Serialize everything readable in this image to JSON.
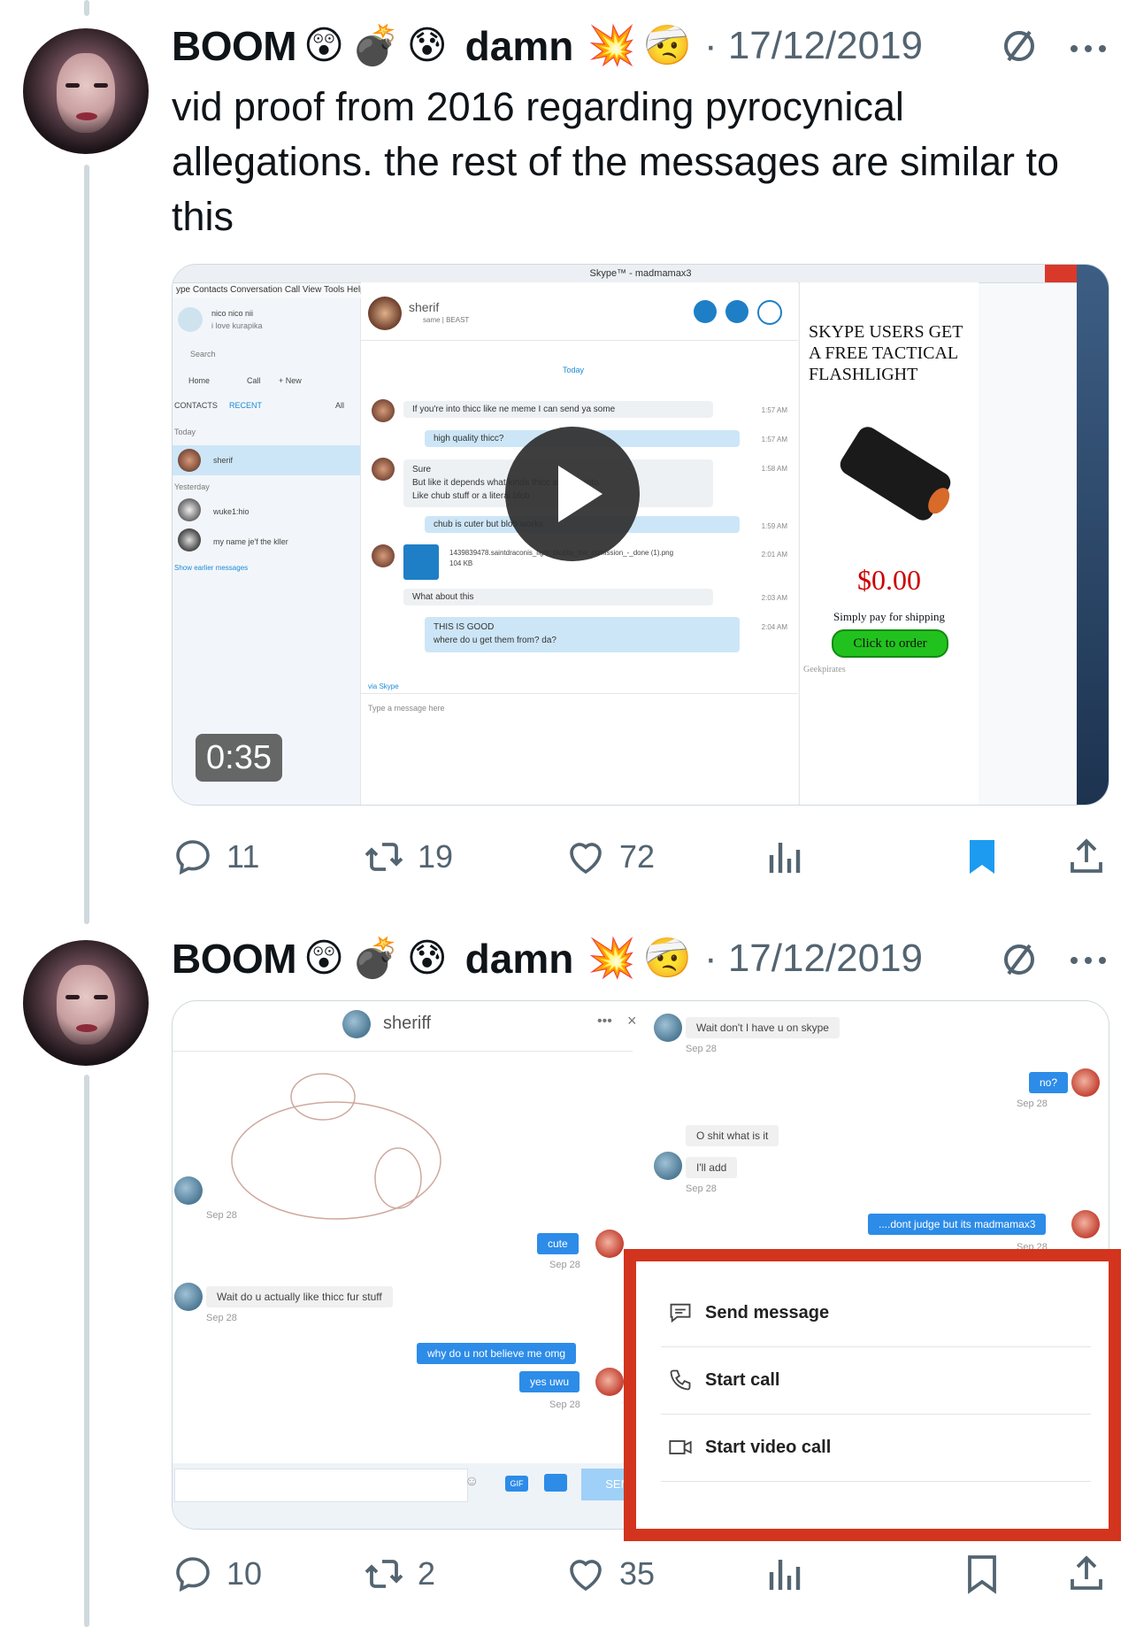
{
  "tweets": [
    {
      "author": "BOOM",
      "name_emoji": [
        "😲",
        "💣",
        "😰"
      ],
      "name_suffix": "damn",
      "suffix_emoji": [
        "💥",
        "🤕"
      ],
      "date": "· 17/12/2019",
      "text": "vid proof from 2016 regarding pyrocynical allegations. the rest of the messages are similar to this",
      "video": {
        "duration": "0:35",
        "skype": {
          "window_title": "Skype™ - madmamax3",
          "menu": "ype   Contacts   Conversation   Call   View   Tools   Help",
          "profile_name": "nico nico nii",
          "profile_status": "i love kurapika",
          "search": "Search",
          "nav": [
            "Home",
            "Call",
            "+ New"
          ],
          "tabs": [
            "CONTACTS",
            "RECENT",
            "All"
          ],
          "groups": [
            "Today",
            "Yesterday"
          ],
          "contacts": [
            "sherif",
            "wuke1:hio",
            "my name je'f the kller"
          ],
          "show_earlier": "Show earlier messages",
          "chat_name": "sherif",
          "chat_status": "same | BEAST",
          "day_label": "Today",
          "messages": [
            {
              "dir": "in",
              "text": "If you're into thicc like ne meme I can send ya some",
              "time": "1:57 AM"
            },
            {
              "dir": "out",
              "text": "high quality thicc?",
              "time": "1:57 AM"
            },
            {
              "dir": "in",
              "text": "Sure\nBut like it depends what kinda thicc are you into\nLike chub stuff or a literal blob",
              "time": "1:58 AM"
            },
            {
              "dir": "out",
              "text": "chub is cuter but blob works",
              "time": "1:59 AM"
            },
            {
              "dir": "in",
              "text": "1439839478.saintdraconis_light_blobby_fox_comission_-_done (1).png\n104 KB",
              "time": "2:01 AM"
            },
            {
              "dir": "in",
              "text": "What about this",
              "time": "2:03 AM"
            },
            {
              "dir": "out",
              "text": "THIS IS GOOD\nwhere do u get them from? da?",
              "time": "2:04 AM"
            }
          ],
          "via": "via Skype",
          "compose_placeholder": "Type a message here",
          "ad": {
            "headline": "SKYPE USERS GET A FREE TACTICAL FLASHLIGHT",
            "price": "$0.00",
            "sub": "Simply pay for shipping",
            "cta": "Click to order",
            "brand": "Geekpirates"
          }
        }
      },
      "stats": {
        "replies": "11",
        "retweets": "19",
        "likes": "72"
      },
      "bookmarked": true
    },
    {
      "author": "BOOM",
      "name_emoji": [
        "😲",
        "💣",
        "😰"
      ],
      "name_suffix": "damn",
      "suffix_emoji": [
        "💥",
        "🤕"
      ],
      "date": "· 17/12/2019",
      "image": {
        "chat_name": "sheriff",
        "left_messages": [
          {
            "dir": "in",
            "text": "",
            "time": "Sep 28"
          },
          {
            "dir": "out",
            "text": "cute",
            "time": "Sep 28"
          },
          {
            "dir": "in",
            "text": "Wait do u actually like thicc fur stuff",
            "time": "Sep 28"
          },
          {
            "dir": "out",
            "text": "why do u not believe me omg",
            "time": ""
          },
          {
            "dir": "out",
            "text": "yes uwu",
            "time": "Sep 28"
          }
        ],
        "right_messages": [
          {
            "dir": "in",
            "text": "Wait don't I have u on skype",
            "time": "Sep 28"
          },
          {
            "dir": "out",
            "text": "no?",
            "time": "Sep 28"
          },
          {
            "dir": "in",
            "text": "O shit what is it",
            "time": ""
          },
          {
            "dir": "in",
            "text": "I'll add",
            "time": "Sep 28"
          },
          {
            "dir": "out",
            "text": "....dont judge but its madmamax3",
            "time": "Sep 28"
          }
        ],
        "send_label": "SEN",
        "gif_label": "GIF",
        "menu": [
          "Send message",
          "Start call",
          "Start video call"
        ]
      },
      "stats": {
        "replies": "10",
        "retweets": "2",
        "likes": "35"
      },
      "bookmarked": false
    }
  ],
  "colors": {
    "bookmark_active": "#1d9bf0",
    "icon_gray": "#536471",
    "highlight_box": "#d3341d",
    "ad_price": "#cc0000",
    "cta_green": "#22c21e"
  }
}
